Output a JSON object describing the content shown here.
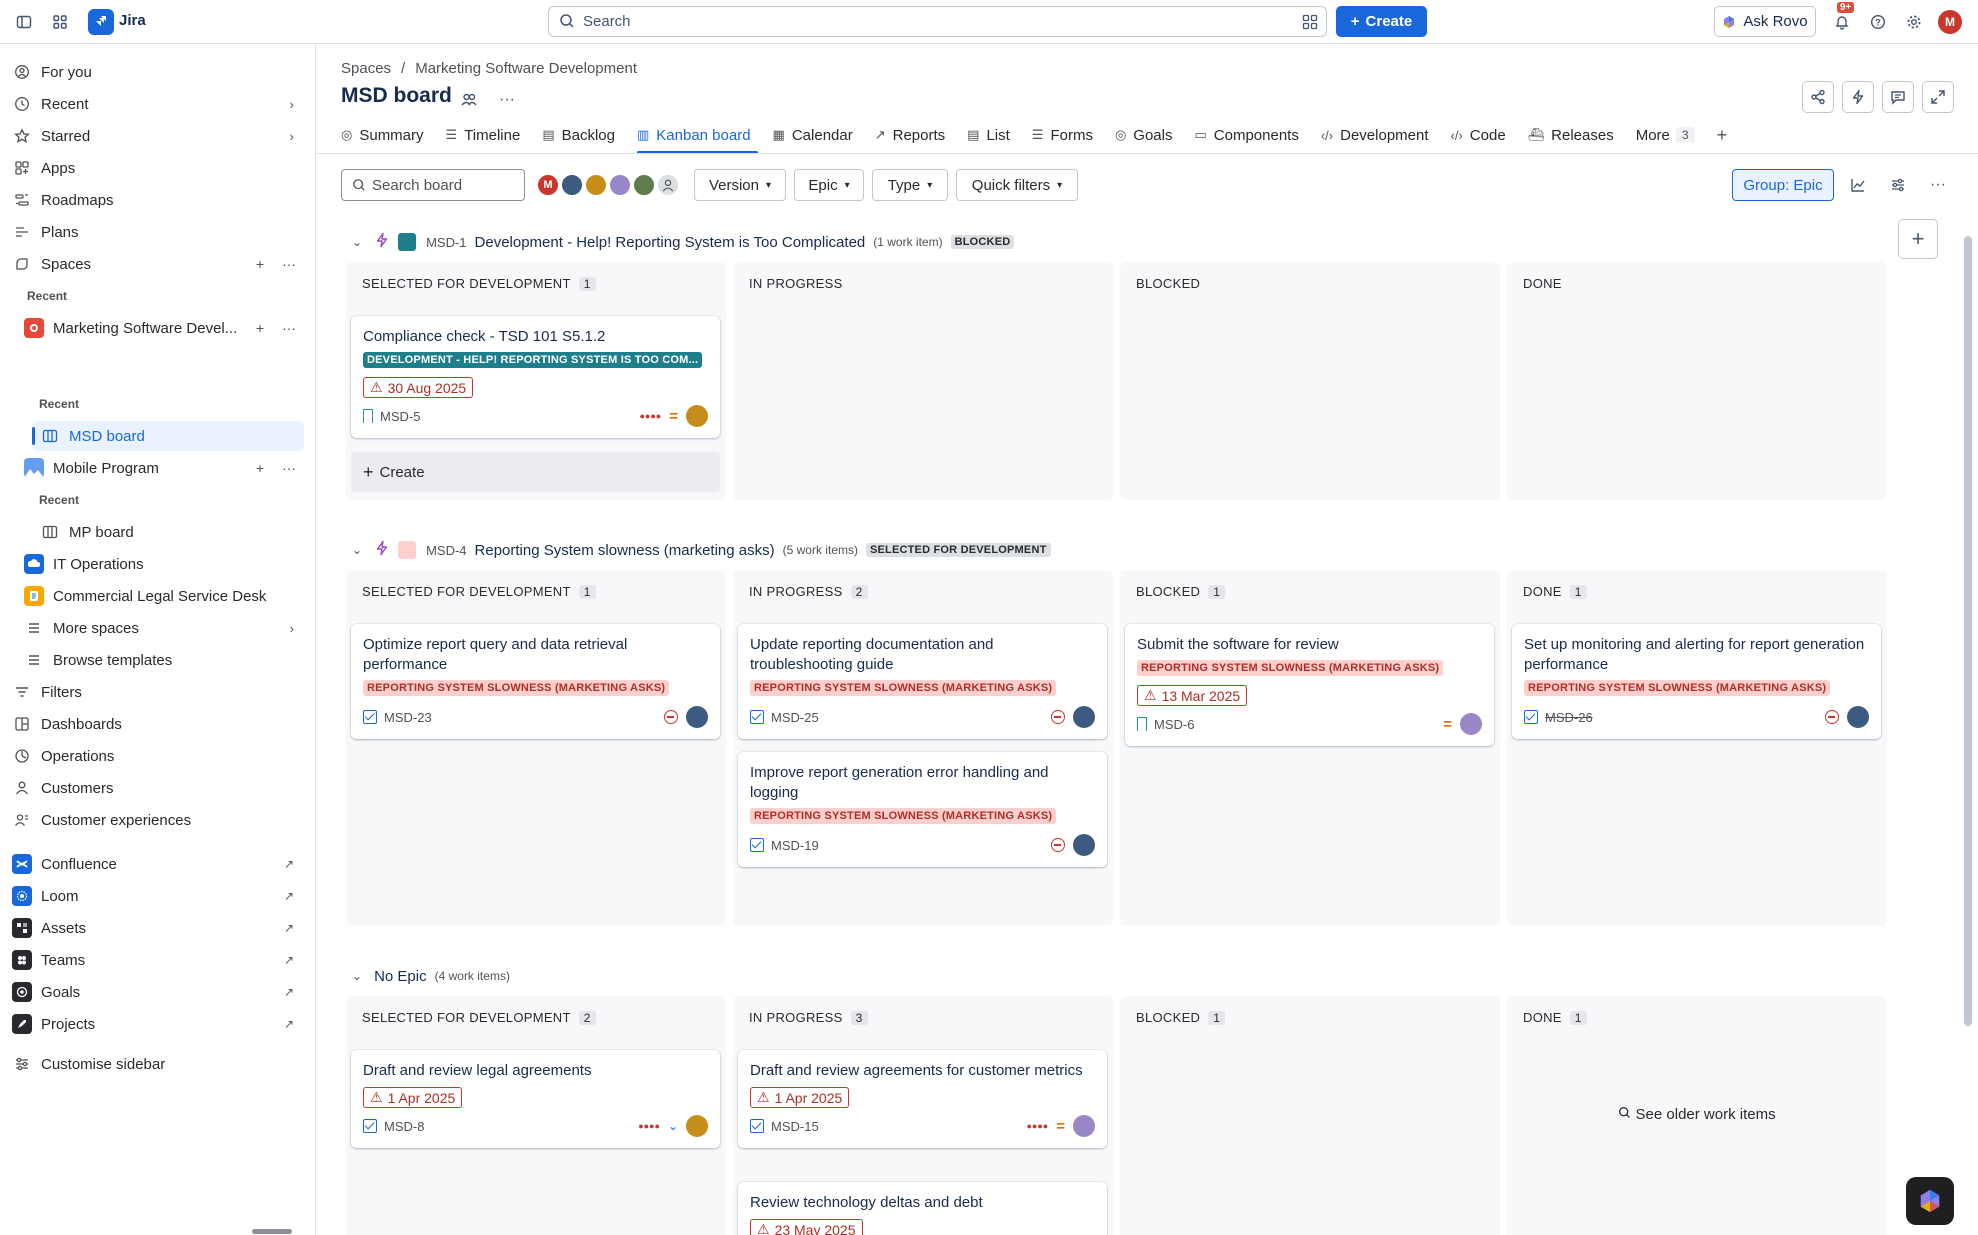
{
  "topbar": {
    "app_name": "Jira",
    "search_placeholder": "Search",
    "create_label": "Create",
    "rovo_label": "Ask Rovo",
    "notif_badge": "9+",
    "user_initial": "M"
  },
  "sidebar": {
    "items": [
      {
        "label": "For you"
      },
      {
        "label": "Recent"
      },
      {
        "label": "Starred"
      },
      {
        "label": "Apps"
      },
      {
        "label": "Roadmaps"
      },
      {
        "label": "Plans"
      },
      {
        "label": "Spaces"
      }
    ],
    "recent_label": "Recent",
    "spaces": [
      {
        "label": "Marketing Software Devel..."
      },
      {
        "label": "Mobile Program"
      },
      {
        "label": "IT Operations"
      },
      {
        "label": "Commercial Legal Service Desk"
      }
    ],
    "msd_board": "MSD board",
    "mp_board": "MP board",
    "more_spaces": "More spaces",
    "browse_templates": "Browse templates",
    "bottom_items": [
      {
        "label": "Filters"
      },
      {
        "label": "Dashboards"
      },
      {
        "label": "Operations"
      },
      {
        "label": "Customers"
      },
      {
        "label": "Customer experiences"
      }
    ],
    "apps": [
      {
        "label": "Confluence"
      },
      {
        "label": "Loom"
      },
      {
        "label": "Assets"
      },
      {
        "label": "Teams"
      },
      {
        "label": "Goals"
      },
      {
        "label": "Projects"
      }
    ],
    "customise": "Customise sidebar"
  },
  "breadcrumb": {
    "root": "Spaces",
    "separator": "/",
    "space": "Marketing Software Development"
  },
  "board_title": "MSD board",
  "tabs": [
    {
      "label": "Summary"
    },
    {
      "label": "Timeline"
    },
    {
      "label": "Backlog"
    },
    {
      "label": "Kanban board"
    },
    {
      "label": "Calendar"
    },
    {
      "label": "Reports"
    },
    {
      "label": "List"
    },
    {
      "label": "Forms"
    },
    {
      "label": "Goals"
    },
    {
      "label": "Components"
    },
    {
      "label": "Development"
    },
    {
      "label": "Code"
    },
    {
      "label": "Releases"
    },
    {
      "label": "More"
    }
  ],
  "more_count": "3",
  "filters": {
    "search_placeholder": "Search board",
    "version": "Version",
    "epic": "Epic",
    "type": "Type",
    "quick": "Quick filters",
    "group": "Group: Epic"
  },
  "lanes": [
    {
      "key": "MSD-1",
      "title": "Development - Help! Reporting System is Too Complicated",
      "count": "(1 work item)",
      "status": "BLOCKED",
      "color": "#1d7f8c"
    },
    {
      "key": "MSD-4",
      "title": "Reporting System slowness (marketing asks)",
      "count": "(5 work items)",
      "status": "SELECTED FOR DEVELOPMENT",
      "color": "#fdd0cd"
    },
    {
      "title": "No Epic",
      "count": "(4 work items)"
    }
  ],
  "columns": {
    "sfd": "SELECTED FOR DEVELOPMENT",
    "ip": "IN PROGRESS",
    "blocked": "BLOCKED",
    "done": "DONE"
  },
  "counts": {
    "l1_sfd": "1",
    "l2_sfd": "1",
    "l2_ip": "2",
    "l2_blocked": "1",
    "l2_done": "1",
    "l3_sfd": "2",
    "l3_ip": "3",
    "l3_blocked": "1",
    "l3_done": "1"
  },
  "cards": {
    "c1": {
      "title": "Compliance check - TSD 101 S5.1.2",
      "epic": "DEVELOPMENT - HELP! REPORTING SYSTEM IS TOO COM...",
      "due": "30 Aug 2025",
      "key": "MSD-5"
    },
    "c2": {
      "title": "Optimize report query and data retrieval performance",
      "epic": "REPORTING SYSTEM SLOWNESS (MARKETING ASKS)",
      "key": "MSD-23"
    },
    "c3": {
      "title": "Update reporting documentation and troubleshooting guide",
      "epic": "REPORTING SYSTEM SLOWNESS (MARKETING ASKS)",
      "key": "MSD-25"
    },
    "c4": {
      "title": "Improve report generation error handling and logging",
      "epic": "REPORTING SYSTEM SLOWNESS (MARKETING ASKS)",
      "key": "MSD-19"
    },
    "c5": {
      "title": "Submit the software for review",
      "epic": "REPORTING SYSTEM SLOWNESS (MARKETING ASKS)",
      "due": "13 Mar 2025",
      "key": "MSD-6"
    },
    "c6": {
      "title": "Set up monitoring and alerting for report generation performance",
      "epic": "REPORTING SYSTEM SLOWNESS (MARKETING ASKS)",
      "key": "MSD-26"
    },
    "c7": {
      "title": "Draft and review legal agreements",
      "due": "1 Apr 2025",
      "key": "MSD-8"
    },
    "c8": {
      "title": "Draft and review agreements for customer metrics",
      "due": "1 Apr 2025",
      "key": "MSD-15"
    },
    "c9": {
      "title": "Review technology deltas and debt",
      "due": "23 May 2025"
    }
  },
  "create_label": "Create",
  "see_older": "See older work items"
}
